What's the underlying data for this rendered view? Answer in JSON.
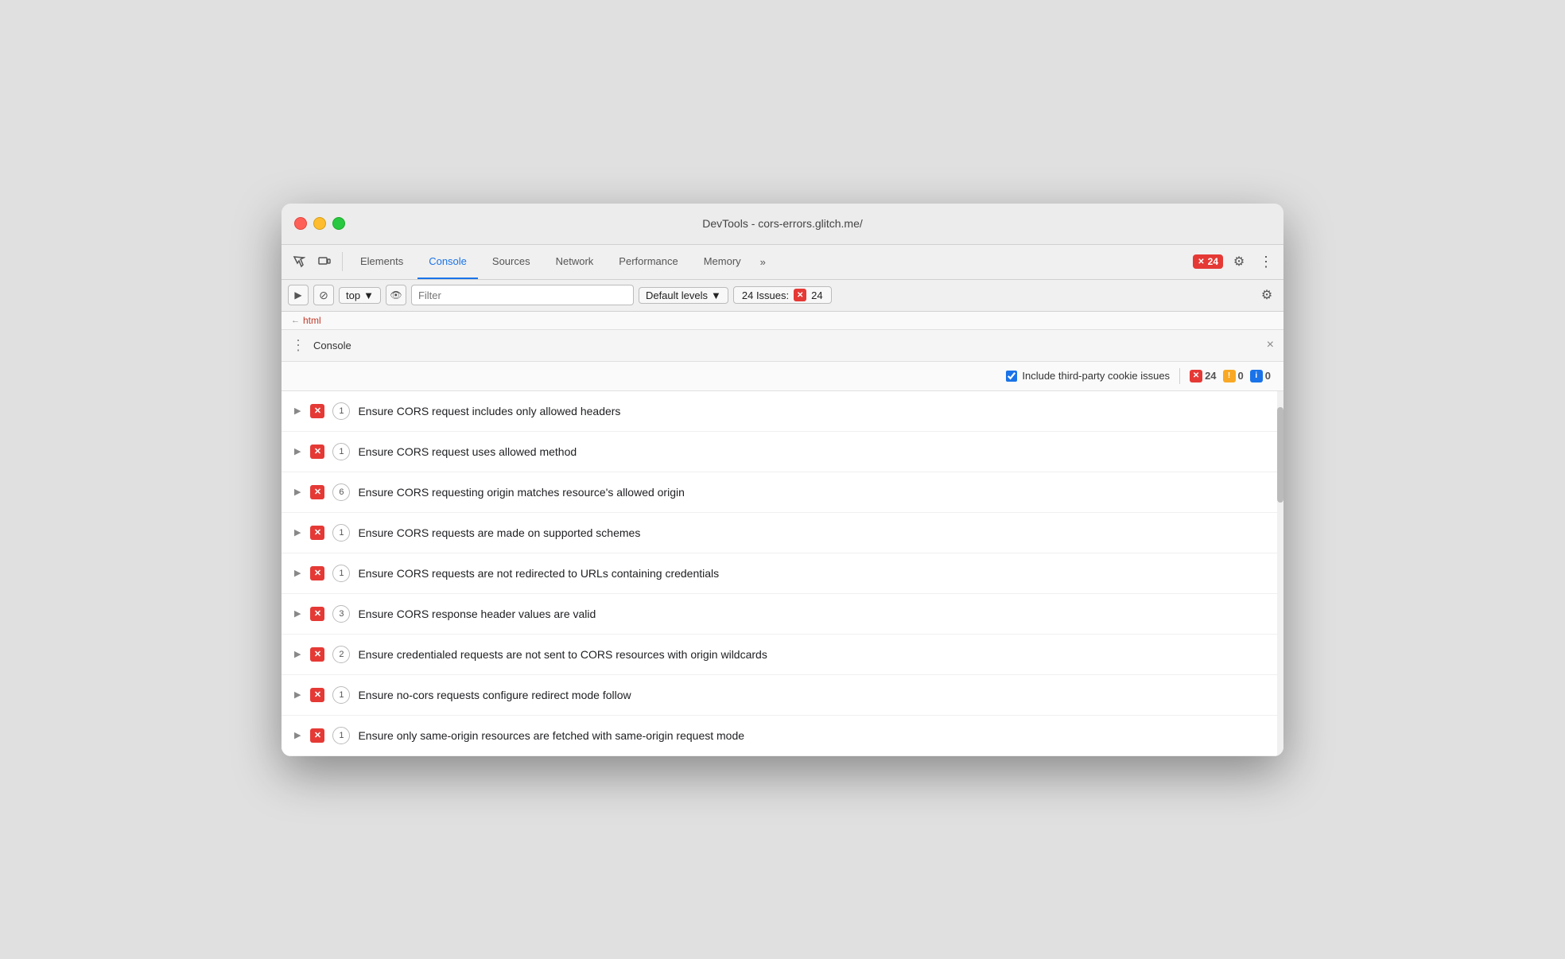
{
  "window": {
    "title": "DevTools - cors-errors.glitch.me/"
  },
  "toolbar": {
    "tabs": [
      {
        "id": "elements",
        "label": "Elements",
        "active": false
      },
      {
        "id": "console",
        "label": "Console",
        "active": true
      },
      {
        "id": "sources",
        "label": "Sources",
        "active": false
      },
      {
        "id": "network",
        "label": "Network",
        "active": false
      },
      {
        "id": "performance",
        "label": "Performance",
        "active": false
      },
      {
        "id": "memory",
        "label": "Memory",
        "active": false
      }
    ],
    "more_label": "»",
    "error_count": "24",
    "gear_label": "⚙",
    "more_dots": "⋮"
  },
  "secondary_toolbar": {
    "play_icon": "▶",
    "block_icon": "⊘",
    "top_label": "top",
    "dropdown_arrow": "▼",
    "eye_icon": "👁",
    "filter_placeholder": "Filter",
    "levels_label": "Default levels",
    "issues_label": "24 Issues:",
    "issues_count": "24",
    "gear_label": "⚙"
  },
  "breadcrumb": {
    "arrow": "←",
    "tag": "html"
  },
  "console_panel": {
    "dots": "⋮",
    "title": "Console",
    "close": "×"
  },
  "issues_toolbar": {
    "checkbox_label": "Include third-party cookie issues",
    "checkbox_checked": true,
    "red_count": "24",
    "yellow_count": "0",
    "blue_count": "0"
  },
  "issues": [
    {
      "text": "Ensure CORS request includes only allowed headers",
      "count": "1",
      "icon": "✕"
    },
    {
      "text": "Ensure CORS request uses allowed method",
      "count": "1",
      "icon": "✕"
    },
    {
      "text": "Ensure CORS requesting origin matches resource's allowed origin",
      "count": "6",
      "icon": "✕"
    },
    {
      "text": "Ensure CORS requests are made on supported schemes",
      "count": "1",
      "icon": "✕"
    },
    {
      "text": "Ensure CORS requests are not redirected to URLs containing credentials",
      "count": "1",
      "icon": "✕"
    },
    {
      "text": "Ensure CORS response header values are valid",
      "count": "3",
      "icon": "✕"
    },
    {
      "text": "Ensure credentialed requests are not sent to CORS resources with origin wildcards",
      "count": "2",
      "icon": "✕"
    },
    {
      "text": "Ensure no-cors requests configure redirect mode follow",
      "count": "1",
      "icon": "✕"
    },
    {
      "text": "Ensure only same-origin resources are fetched with same-origin request mode",
      "count": "1",
      "icon": "✕"
    }
  ]
}
